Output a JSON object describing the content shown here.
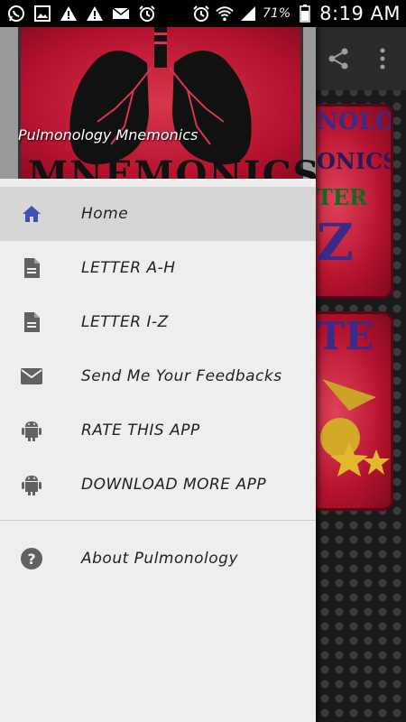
{
  "status_bar": {
    "battery_percent": "71%",
    "time": "8:19 AM"
  },
  "drawer": {
    "header_title": "Pulmonology Mnemonics",
    "header_art_text": "MNEMONICS",
    "items": [
      {
        "label": "Home",
        "icon": "home-icon",
        "selected": true
      },
      {
        "label": "LETTER A-H",
        "icon": "document-icon"
      },
      {
        "label": "LETTER I-Z",
        "icon": "document-icon"
      },
      {
        "label": "Send Me Your Feedbacks",
        "icon": "mail-icon"
      },
      {
        "label": "RATE THIS APP",
        "icon": "android-icon"
      },
      {
        "label": "DOWNLOAD MORE APP",
        "icon": "android-icon"
      },
      {
        "label": "About Pulmonology",
        "icon": "help-icon"
      }
    ]
  },
  "background": {
    "tile1_lines": [
      "NOLOGY",
      "ONICS",
      "TER",
      "Z"
    ],
    "tile2_lines": [
      "TE"
    ]
  },
  "colors": {
    "accent": "#3f51b5",
    "drawer_bg": "#eeeeee",
    "selected_bg": "#d6d6d6",
    "tile_red": "#b5122e"
  }
}
